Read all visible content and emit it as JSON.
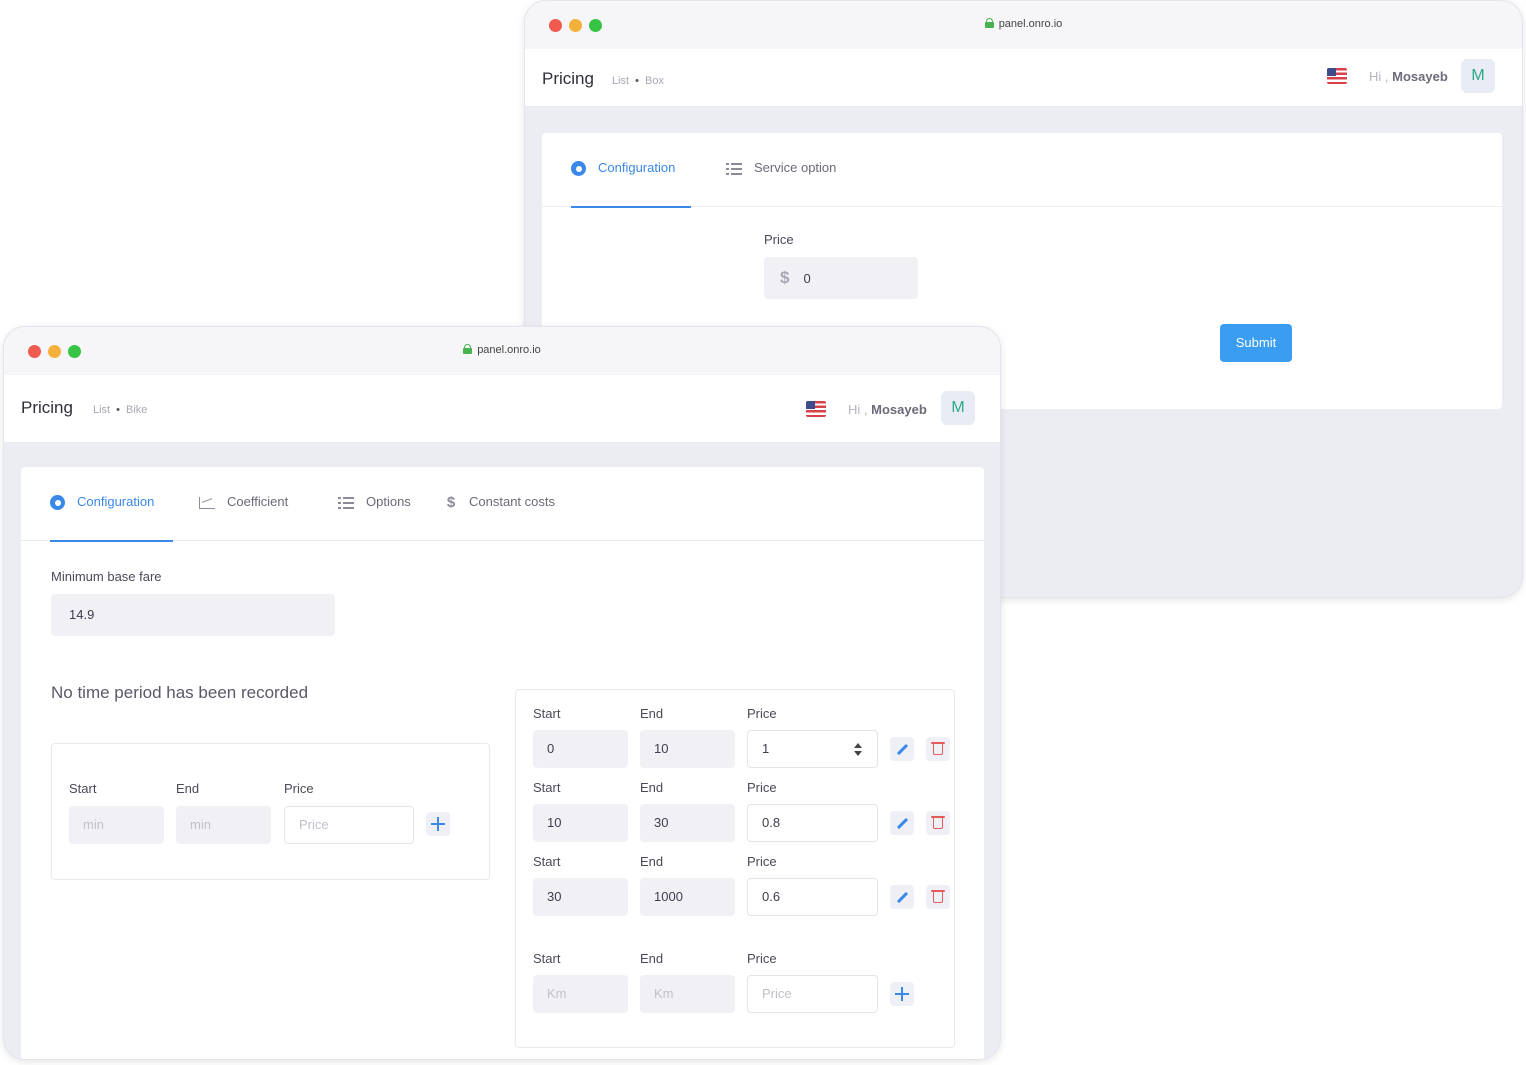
{
  "back_window": {
    "url": "panel.onro.io",
    "title": "Pricing",
    "breadcrumb": [
      "List",
      "Box"
    ],
    "greeting_prefix": "Hi ,",
    "user_name": "Mosayeb",
    "avatar_initial": "M",
    "tabs": [
      {
        "label": "Configuration",
        "icon": "gear-icon",
        "active": true
      },
      {
        "label": "Service option",
        "icon": "list-icon",
        "active": false
      }
    ],
    "price_label": "Price",
    "price_value": "0",
    "currency_symbol": "$",
    "submit_label": "Submit"
  },
  "front_window": {
    "url": "panel.onro.io",
    "title": "Pricing",
    "breadcrumb": [
      "List",
      "Bike"
    ],
    "greeting_prefix": "Hi ,",
    "user_name": "Mosayeb",
    "avatar_initial": "M",
    "tabs": [
      {
        "label": "Configuration",
        "icon": "gear-icon",
        "active": true
      },
      {
        "label": "Coefficient",
        "icon": "chart-icon",
        "active": false
      },
      {
        "label": "Options",
        "icon": "list-icon",
        "active": false
      },
      {
        "label": "Constant costs",
        "icon": "dollar-icon",
        "active": false
      }
    ],
    "min_base_fare_label": "Minimum base fare",
    "min_base_fare_value": "14.9",
    "time_period_heading": "No time period has been recorded",
    "time_new_row": {
      "start_label": "Start",
      "end_label": "End",
      "price_label": "Price",
      "start_placeholder": "min",
      "end_placeholder": "min",
      "price_placeholder": "Price"
    },
    "distance_rows": [
      {
        "start_label": "Start",
        "end_label": "End",
        "price_label": "Price",
        "start": "0",
        "end": "10",
        "price": "1"
      },
      {
        "start_label": "Start",
        "end_label": "End",
        "price_label": "Price",
        "start": "10",
        "end": "30",
        "price": "0.8"
      },
      {
        "start_label": "Start",
        "end_label": "End",
        "price_label": "Price",
        "start": "30",
        "end": "1000",
        "price": "0.6"
      }
    ],
    "distance_new_row": {
      "start_label": "Start",
      "end_label": "End",
      "price_label": "Price",
      "start_placeholder": "Km",
      "end_placeholder": "Km",
      "price_placeholder": "Price"
    }
  },
  "colors": {
    "accent": "#3a88e8",
    "submit": "#3a9df2",
    "delete": "#e65a5a",
    "avatar_text": "#2ba98a",
    "window_bg": "#ececf3"
  }
}
